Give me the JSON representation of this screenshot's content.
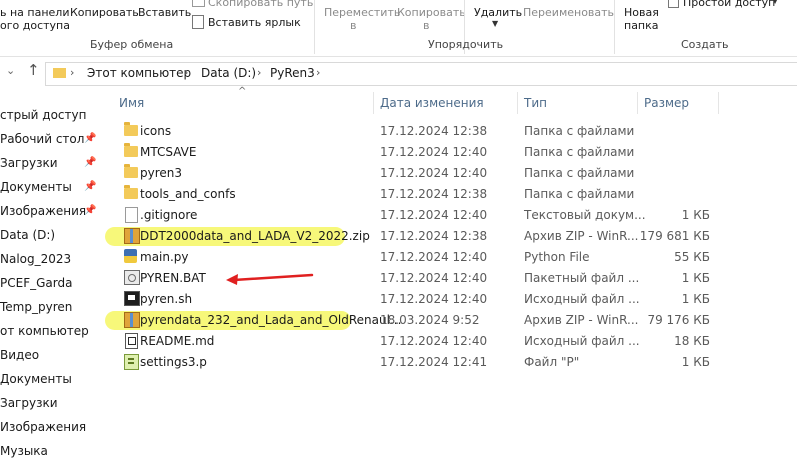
{
  "ribbon": {
    "clipboard": {
      "pin_label_1": "ь на панели",
      "pin_label_2": "ого доступа",
      "copy": "Копировать",
      "paste": "Вставить",
      "copy_path": "Скопировать путь",
      "paste_shortcut": "Вставить ярлык",
      "group": "Буфер обмена"
    },
    "organize": {
      "move_1": "Переместить",
      "move_2": "в",
      "copy_1": "Копировать",
      "copy_2": "в",
      "delete": "Удалить",
      "rename": "Переименовать",
      "group": "Упорядочить"
    },
    "new": {
      "new_folder_1": "Новая",
      "new_folder_2": "папка",
      "easy_access": "Простой доступ",
      "group": "Создать"
    }
  },
  "address": {
    "crumbs": [
      "Этот компьютер",
      "Data (D:)",
      "PyRen3"
    ]
  },
  "nav": {
    "items": [
      {
        "label": "стрый доступ",
        "pinned": false
      },
      {
        "label": "Рабочий стол",
        "pinned": true
      },
      {
        "label": "Загрузки",
        "pinned": true
      },
      {
        "label": "Документы",
        "pinned": true
      },
      {
        "label": "Изображения",
        "pinned": true
      },
      {
        "label": "Data (D:)",
        "pinned": false
      },
      {
        "label": "Nalog_2023",
        "pinned": false
      },
      {
        "label": "PCEF_Garda",
        "pinned": false
      },
      {
        "label": "Temp_pyren",
        "pinned": false
      },
      {
        "label": "от компьютер",
        "pinned": false
      },
      {
        "label": "Видео",
        "pinned": false
      },
      {
        "label": "Документы",
        "pinned": false
      },
      {
        "label": "Загрузки",
        "pinned": false
      },
      {
        "label": "Изображения",
        "pinned": false
      },
      {
        "label": "Музыка",
        "pinned": false
      }
    ]
  },
  "columns": {
    "name": "Имя",
    "date": "Дата изменения",
    "type": "Тип",
    "size": "Размер"
  },
  "files": [
    {
      "name": "icons",
      "date": "17.12.2024 12:38",
      "type": "Папка с файлами",
      "size": "",
      "icon": "folder"
    },
    {
      "name": "MTCSAVE",
      "date": "17.12.2024 12:40",
      "type": "Папка с файлами",
      "size": "",
      "icon": "folder"
    },
    {
      "name": "pyren3",
      "date": "17.12.2024 12:40",
      "type": "Папка с файлами",
      "size": "",
      "icon": "folder"
    },
    {
      "name": "tools_and_confs",
      "date": "17.12.2024 12:38",
      "type": "Папка с файлами",
      "size": "",
      "icon": "folder"
    },
    {
      "name": ".gitignore",
      "date": "17.12.2024 12:40",
      "type": "Текстовый докум...",
      "size": "1 КБ",
      "icon": "file"
    },
    {
      "name": "DDT2000data_and_LADA_V2_2022.zip",
      "date": "17.12.2024 12:38",
      "type": "Архив ZIP - WinR...",
      "size": "179 681 КБ",
      "icon": "zip",
      "highlight": true
    },
    {
      "name": "main.py",
      "date": "17.12.2024 12:40",
      "type": "Python File",
      "size": "55 КБ",
      "icon": "py"
    },
    {
      "name": "PYREN.BAT",
      "date": "17.12.2024 12:40",
      "type": "Пакетный файл ...",
      "size": "1 КБ",
      "icon": "bat"
    },
    {
      "name": "pyren.sh",
      "date": "17.12.2024 12:40",
      "type": "Исходный файл ...",
      "size": "1 КБ",
      "icon": "sh"
    },
    {
      "name": "pyrendata_232_and_Lada_and_OldRenaul...",
      "date": "18.03.2024 9:52",
      "type": "Архив ZIP - WinR...",
      "size": "79 176 КБ",
      "icon": "zip",
      "highlight": true
    },
    {
      "name": "README.md",
      "date": "17.12.2024 12:40",
      "type": "Исходный файл ...",
      "size": "18 КБ",
      "icon": "md"
    },
    {
      "name": "settings3.p",
      "date": "17.12.2024 12:41",
      "type": "Файл \"P\"",
      "size": "1 КБ",
      "icon": "p"
    }
  ],
  "colors": {
    "highlight": "#f7f87a",
    "arrow": "#e02020",
    "header_text": "#4d6b8a"
  }
}
